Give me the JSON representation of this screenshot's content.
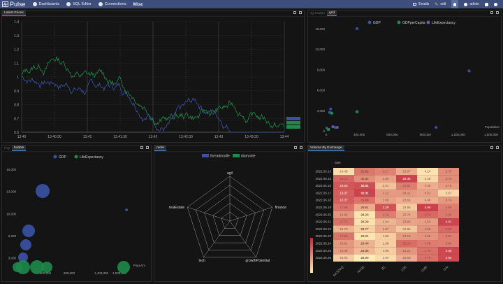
{
  "app": {
    "name": "Pulse"
  },
  "nav": [
    {
      "label": "Dashboards",
      "icon": "dashboard-icon"
    },
    {
      "label": "SQL Editor",
      "icon": "database-icon"
    },
    {
      "label": "Connections",
      "icon": "plug-icon"
    },
    {
      "label": "Misc",
      "icon": ""
    }
  ],
  "topright": {
    "emails": "Emails",
    "edit": "edit",
    "admin": "admin"
  },
  "panels": {
    "latest": {
      "tab": "Latest Prices"
    },
    "gdp": {
      "tabs": [
        "sg-scatter",
        "grid"
      ]
    },
    "bubble": {
      "tabs": [
        "Pxy",
        "bubble"
      ]
    },
    "radar": {
      "tab": "radar"
    },
    "volume": {
      "tab": "Volume By Exchange"
    }
  },
  "chart_data": [
    {
      "type": "line",
      "title": "Latest Prices",
      "x": [
        "13:40",
        "13:40:30",
        "13:41",
        "13:41:30",
        "13:42",
        "13:42:30",
        "13:43",
        "13:43:30",
        "13:44"
      ],
      "ylim": [
        0.6,
        1.4
      ],
      "yticks": [
        "1.4",
        "1.3",
        "1.2",
        "1.1",
        "1",
        "0.9",
        "0.8",
        "0.7",
        "0.6"
      ],
      "series": [
        {
          "name": "",
          "color": "#3a52a6"
        },
        {
          "name": "",
          "color": "#1e8a4a"
        }
      ]
    },
    {
      "type": "scatter",
      "legend": [
        "GDP",
        "GDPperCapita",
        "LifeExpectancy"
      ],
      "yticks": [
        "15,000",
        "12,000",
        "9,000",
        "6,000",
        "3,000",
        "0"
      ],
      "xticks": [
        "0",
        "300,000",
        "600,000",
        "900,000",
        "1,200,000",
        "1,500,000"
      ],
      "xlabel": "Population",
      "points": [
        {
          "x": 5000,
          "y": 400,
          "s": "GDP"
        },
        {
          "x": 30000,
          "y": 2700,
          "s": "GDP"
        },
        {
          "x": 40000,
          "y": 3200,
          "s": "GDP"
        },
        {
          "x": 50000,
          "y": 2600,
          "s": "GDPperCapita"
        },
        {
          "x": 60000,
          "y": 600,
          "s": "LifeExpectancy"
        },
        {
          "x": 20000,
          "y": 200,
          "s": "GDPperCapita"
        },
        {
          "x": 280000,
          "y": 15000,
          "s": "GDP"
        },
        {
          "x": 280000,
          "y": 2800,
          "s": "GDPperCapita"
        },
        {
          "x": 1300000,
          "y": 8800,
          "s": "GDP"
        },
        {
          "x": 1000000,
          "y": 500,
          "s": "GDP"
        },
        {
          "x": 80000,
          "y": 500,
          "s": "GDP"
        },
        {
          "x": 100000,
          "y": 500,
          "s": "LifeExpectancy"
        }
      ]
    },
    {
      "type": "scatter",
      "legend": [
        "GDP",
        "LifeExpectancy"
      ],
      "yticks": [
        "16,000",
        "13,000",
        "10,000",
        "6,000",
        "3,000"
      ],
      "xticks": [
        "600,000",
        "900,000",
        "1,400,000",
        "1,500,000"
      ],
      "xlabel": "PopuAm"
    },
    {
      "type": "radar",
      "legend": [
        "threadmodle",
        "diamonte"
      ],
      "axes": [
        "agil",
        "finance",
        "growthPotential",
        "tech",
        "realEstate"
      ]
    },
    {
      "type": "heatmap",
      "title": "Volume By Exchange",
      "ylabel": "date",
      "columns": [
        "NASDAQ",
        "NYSE",
        "BZ",
        "LSE",
        "CME",
        "DAI"
      ],
      "rows": [
        {
          "date": "2022.06.14",
          "v": [
            "14.46",
            "31.02",
            "2.17",
            "23.67",
            "4.24",
            "3.79"
          ]
        },
        {
          "date": "2022.06.15",
          "v": [
            "18.11",
            "30.41",
            "2.09",
            "26.36",
            "4.28",
            "3.79"
          ]
        },
        {
          "date": "2022.06.16",
          "v": [
            "18.55",
            "32.01",
            "2.01",
            "24.81",
            "4.46",
            "3.75"
          ]
        },
        {
          "date": "2022.06.17",
          "v": [
            "18.37",
            "32.31",
            "2.11",
            "24.11",
            "4.51",
            "3.57"
          ]
        },
        {
          "date": "2022.06.18",
          "v": [
            "18.37",
            "31.09",
            "2.09",
            "23.62",
            "4.46",
            "3.76"
          ]
        },
        {
          "date": "2022.06.19",
          "v": [
            "17.68",
            "29.61",
            "2.29",
            "22.86",
            "4.90",
            "3.84"
          ]
        },
        {
          "date": "2022.06.20",
          "v": [
            "16.62",
            "28.20",
            "2.18",
            "23.74",
            "4.74",
            "3.85"
          ]
        },
        {
          "date": "2022.06.21",
          "v": [
            "17.72",
            "28.29",
            "2.04",
            "23.85",
            "4.52",
            "4.01"
          ]
        },
        {
          "date": "2022.06.22",
          "v": [
            "15.78",
            "28.77",
            "2.07",
            "22.95",
            "4.56",
            "3.90"
          ]
        },
        {
          "date": "2022.06.23",
          "v": [
            "17.66",
            "28.21",
            "1.98",
            "24.12",
            "4.56",
            "3.84"
          ]
        },
        {
          "date": "2022.06.24",
          "v": [
            "16.61",
            "29.49",
            "1.98",
            "25.24",
            "4.66",
            "3.84"
          ]
        },
        {
          "date": "2022.06.25",
          "v": [
            "16.49",
            "29.36",
            "1.98",
            "24.21",
            "4.70",
            "4.00"
          ]
        },
        {
          "date": "2022.06.26",
          "v": [
            "15.02",
            "28.00",
            "1.94",
            "23.63",
            "4.70",
            "4.00"
          ]
        }
      ]
    }
  ]
}
